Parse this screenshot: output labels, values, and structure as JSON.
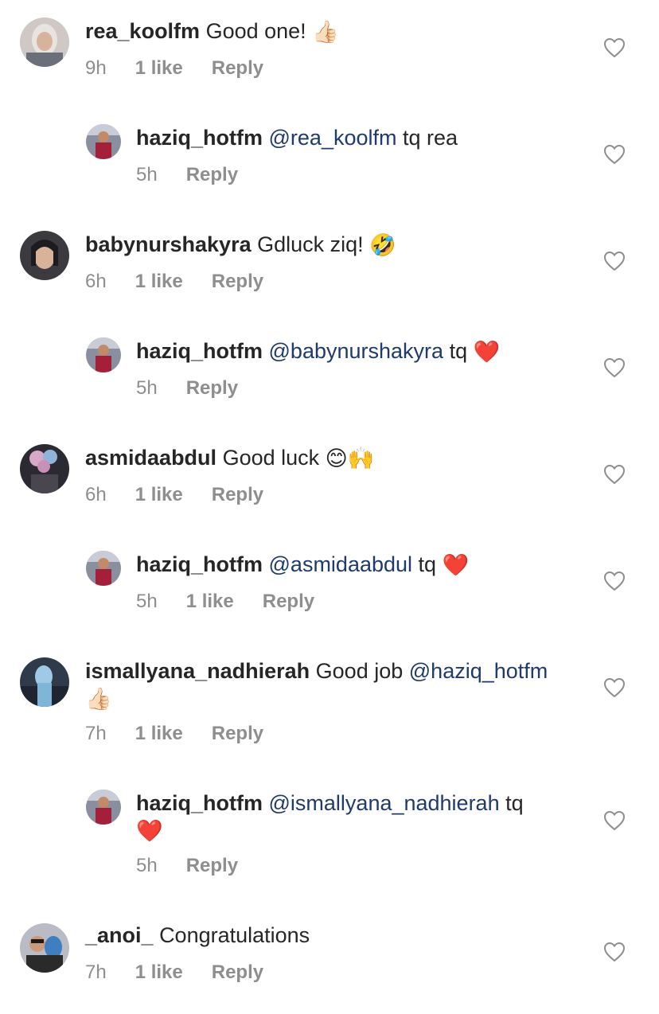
{
  "comments": [
    {
      "username": "rea_koolfm",
      "mention": "",
      "text": "Good one!",
      "emoji": "👍🏻",
      "time": "9h",
      "likes": "1 like",
      "reply": "Reply"
    },
    {
      "username": "haziq_hotfm",
      "mention": "@rea_koolfm",
      "text": "tq rea",
      "emoji": "",
      "time": "5h",
      "likes": "",
      "reply": "Reply"
    },
    {
      "username": "babynurshakyra",
      "mention": "",
      "text": "Gdluck ziq!",
      "emoji": "🤣",
      "time": "6h",
      "likes": "1 like",
      "reply": "Reply"
    },
    {
      "username": "haziq_hotfm",
      "mention": "@babynurshakyra",
      "text": "tq",
      "emoji": "❤️",
      "time": "5h",
      "likes": "",
      "reply": "Reply"
    },
    {
      "username": "asmidaabdul",
      "mention": "",
      "text": "Good luck",
      "emoji": "😊🙌",
      "time": "6h",
      "likes": "1 like",
      "reply": "Reply"
    },
    {
      "username": "haziq_hotfm",
      "mention": "@asmidaabdul",
      "text": "tq",
      "emoji": "❤️",
      "time": "5h",
      "likes": "1 like",
      "reply": "Reply"
    },
    {
      "username": "ismallyana_nadhierah",
      "mention": "",
      "text": "Good job",
      "mention_after": "@haziq_hotfm",
      "emoji": "👍🏻",
      "time": "7h",
      "likes": "1 like",
      "reply": "Reply"
    },
    {
      "username": "haziq_hotfm",
      "mention": "@ismallyana_nadhierah",
      "text": "tq",
      "emoji": "❤️",
      "time": "5h",
      "likes": "",
      "reply": "Reply"
    },
    {
      "username": "_anoi_",
      "mention": "",
      "text": "Congratulations",
      "emoji": "",
      "time": "7h",
      "likes": "1 like",
      "reply": "Reply"
    }
  ],
  "colors": {
    "text": "#262626",
    "meta": "#8e8e8e",
    "mention": "#1e3a6e"
  },
  "icons": {
    "like": "heart-outline-icon"
  }
}
